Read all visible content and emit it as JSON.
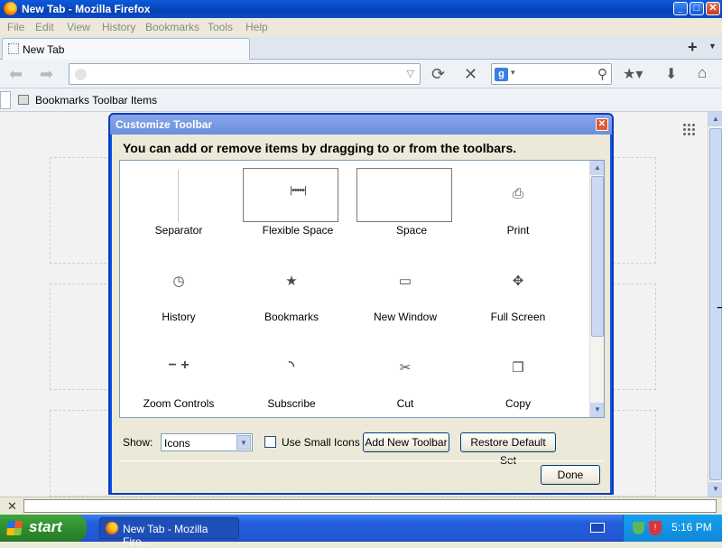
{
  "window": {
    "title": "New Tab - Mozilla Firefox",
    "minimize": "_",
    "maximize": "□",
    "close": "✕"
  },
  "menu": [
    "File",
    "Edit",
    "View",
    "History",
    "Bookmarks",
    "Tools",
    "Help"
  ],
  "tabs": {
    "active_label": "New Tab",
    "new_tab_glyph": "+",
    "list_glyph": "▼"
  },
  "navbar": {
    "back": "⬅",
    "forward": "➡",
    "url_value": "",
    "dropdown": "▽",
    "reload": "⟳",
    "stop": "✕",
    "search_engine_glyph": "g",
    "search_dd": "▾",
    "search_value": "",
    "search_glyph": "⚲",
    "bookmark_glyph": "★▾",
    "download_glyph": "⬇",
    "home_glyph": "⌂"
  },
  "bookmarks_bar": {
    "label": "Bookmarks Toolbar Items"
  },
  "dialog": {
    "title": "Customize Toolbar",
    "close_glyph": "✕",
    "heading": "You can add or remove items by dragging to or from the toolbars.",
    "items": [
      {
        "label": "Separator",
        "icon": "separator-line",
        "glyph": ""
      },
      {
        "label": "Flexible Space",
        "icon": "flexible-space",
        "glyph": "|•••••|"
      },
      {
        "label": "Space",
        "icon": "space",
        "glyph": ""
      },
      {
        "label": "Print",
        "icon": "printer",
        "glyph": "⎙"
      },
      {
        "label": "History",
        "icon": "clock",
        "glyph": "◷"
      },
      {
        "label": "Bookmarks",
        "icon": "bookmark-star",
        "glyph": "★"
      },
      {
        "label": "New Window",
        "icon": "window",
        "glyph": "▭"
      },
      {
        "label": "Full Screen",
        "icon": "fullscreen",
        "glyph": "✥"
      },
      {
        "label": "Zoom Controls",
        "icon": "zoom",
        "glyph": "−  +"
      },
      {
        "label": "Subscribe",
        "icon": "rss",
        "glyph": "◝"
      },
      {
        "label": "Cut",
        "icon": "scissors",
        "glyph": "✂"
      },
      {
        "label": "Copy",
        "icon": "copy",
        "glyph": "❐"
      }
    ],
    "show_label": "Show:",
    "show_value": "Icons",
    "small_icons_label": "Use Small Icons",
    "small_icons_checked": false,
    "add_toolbar_label": "Add New Toolbar",
    "restore_label": "Restore Default Set",
    "done_label": "Done"
  },
  "findbar": {
    "close_glyph": "✕"
  },
  "taskbar": {
    "start_label": "start",
    "task_label": "New Tab - Mozilla Fire...",
    "clock": "5:16 PM"
  }
}
